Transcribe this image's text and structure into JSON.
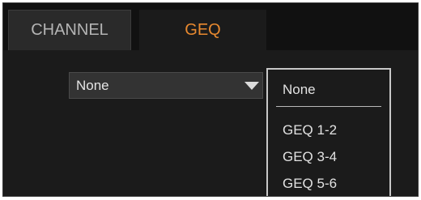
{
  "tabs": [
    {
      "label": "CHANNEL",
      "active": false
    },
    {
      "label": "GEQ",
      "active": true
    }
  ],
  "selector": {
    "selected_label": "None"
  },
  "dropdown": {
    "options": [
      "None",
      "GEQ 1-2",
      "GEQ 3-4",
      "GEQ 5-6"
    ]
  },
  "colors": {
    "active_tab_text": "#e8892f",
    "inactive_tab_text": "#b4b4b4",
    "background": "#1b1b1b"
  }
}
